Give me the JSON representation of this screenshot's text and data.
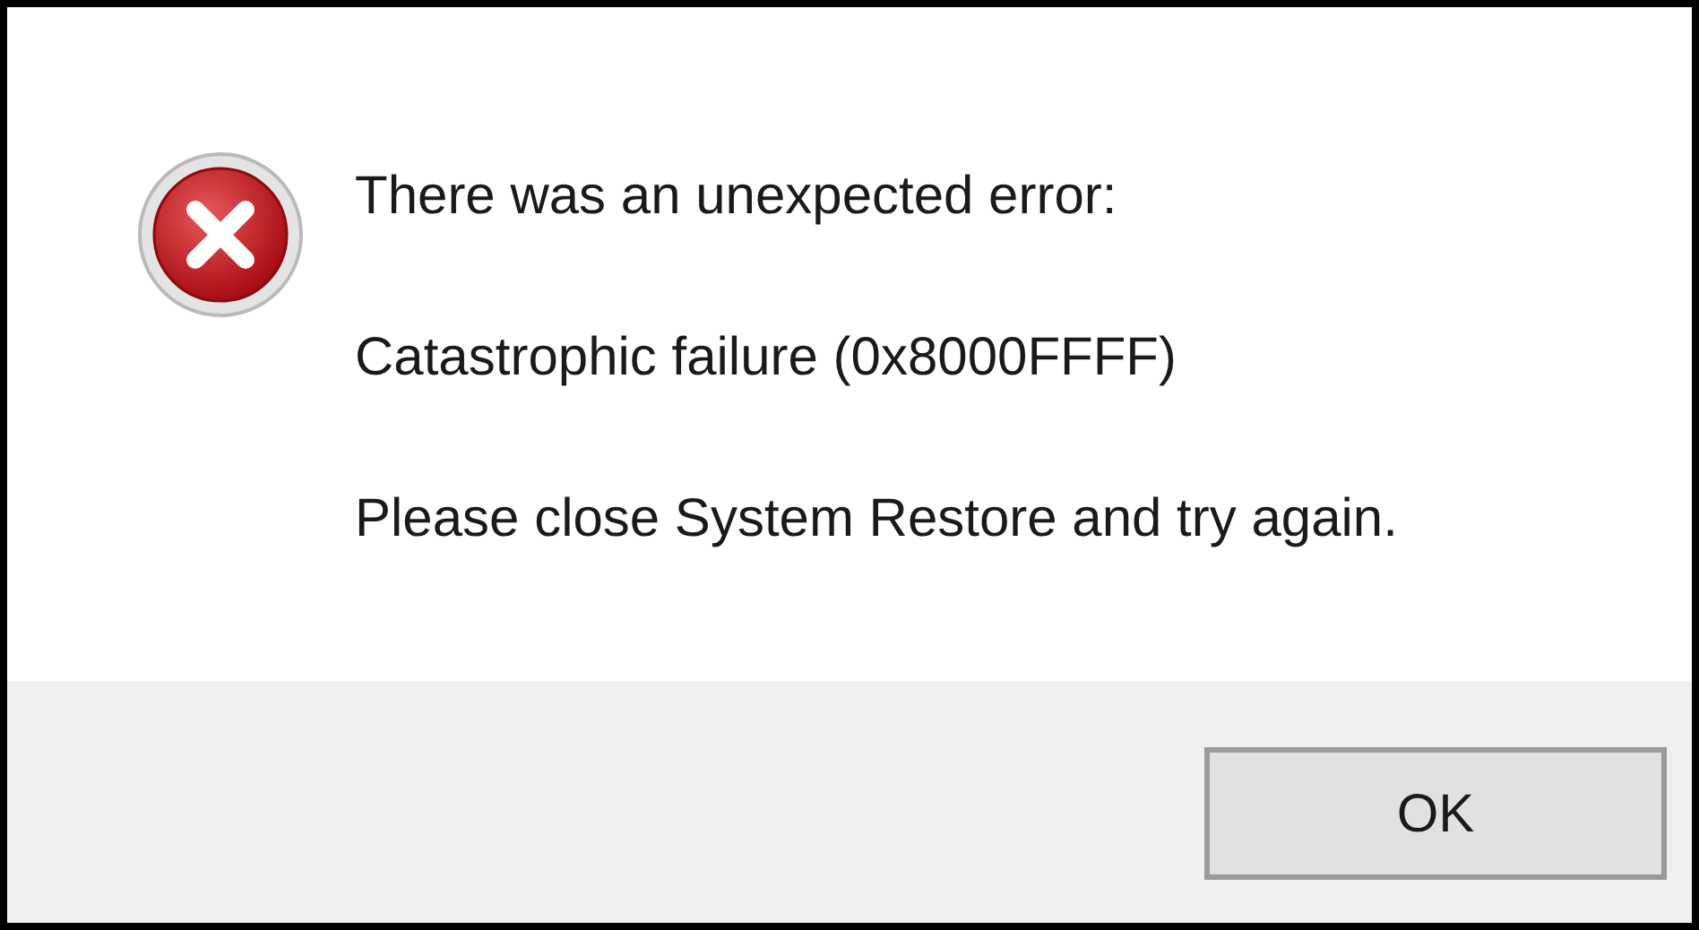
{
  "messages": [
    "There was an unexpected error:",
    "Catastrophic failure (0x8000FFFF)",
    "Please close System Restore and try again."
  ],
  "buttons": [
    {
      "label": "OK",
      "selected": true
    }
  ]
}
